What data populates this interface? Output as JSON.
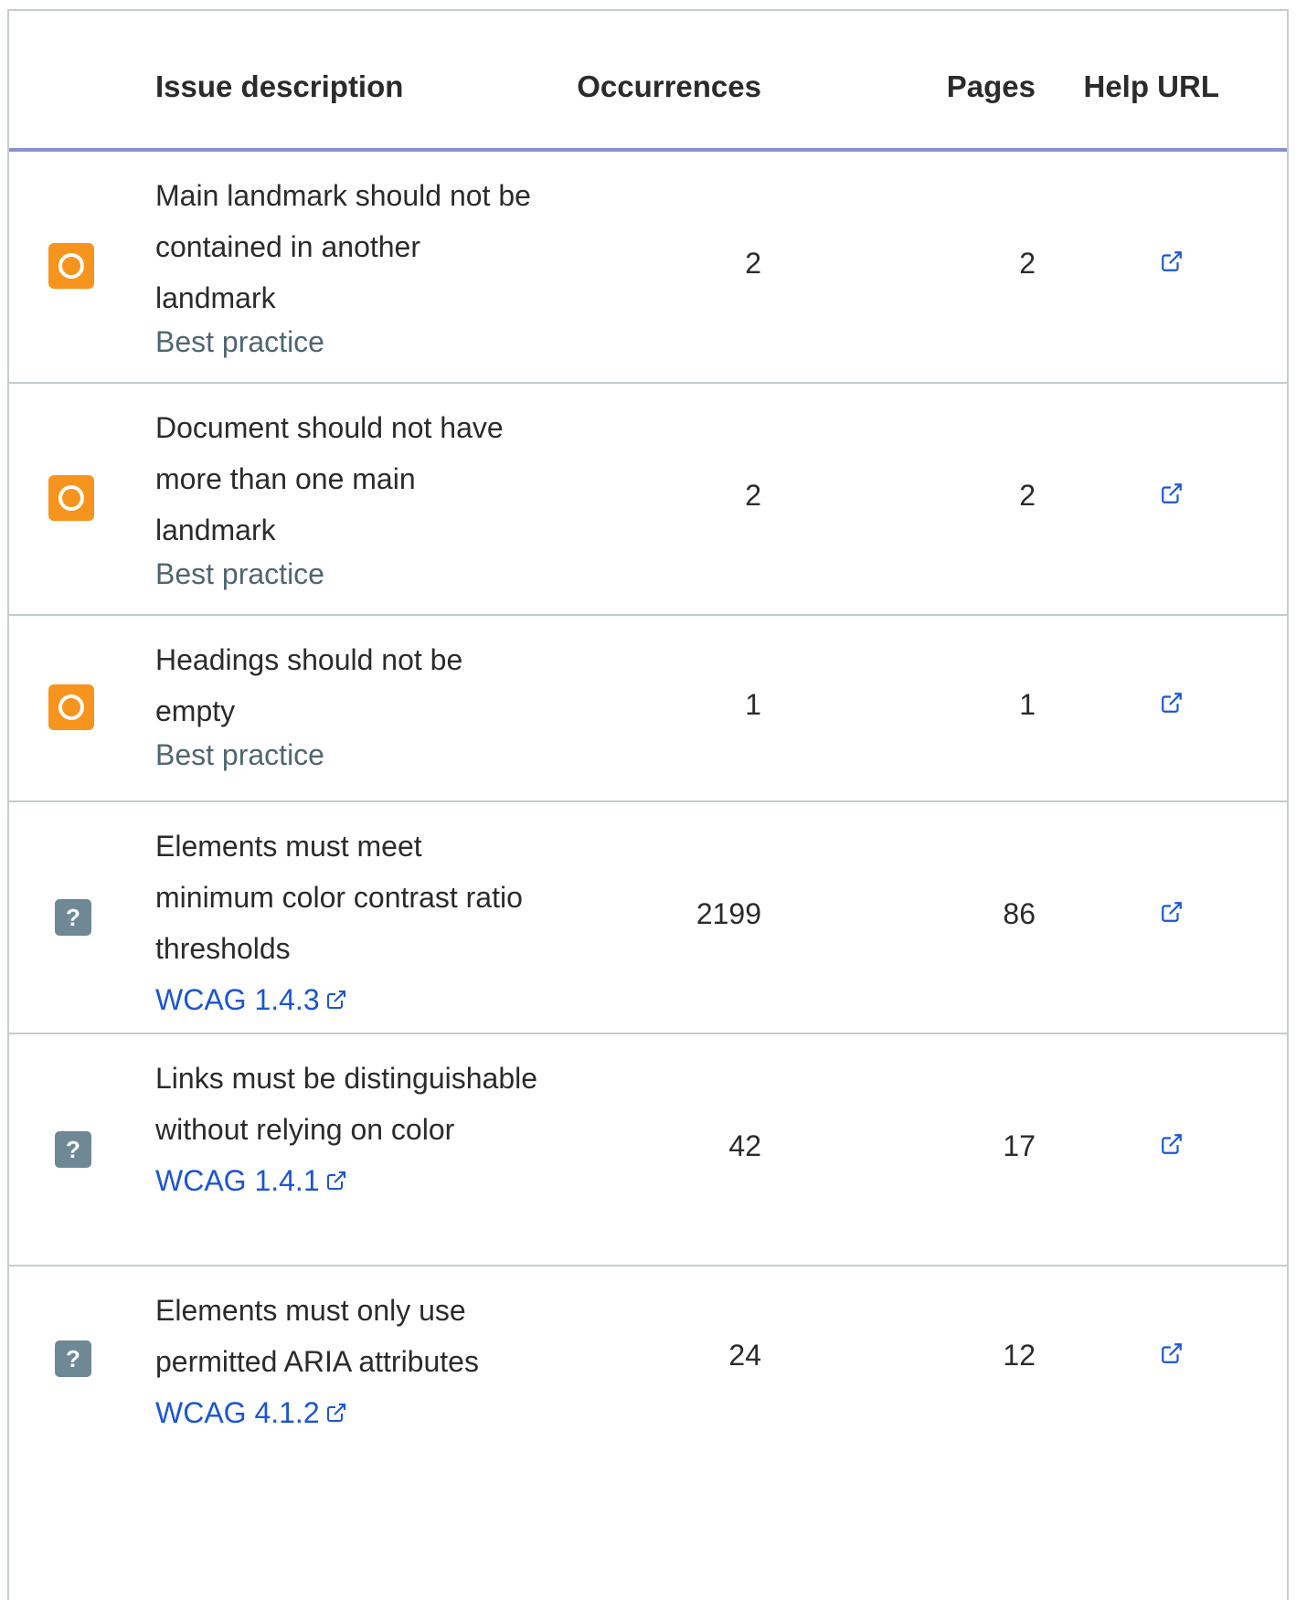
{
  "headers": {
    "issue": "Issue description",
    "occurrences": "Occurrences",
    "pages": "Pages",
    "help": "Help URL"
  },
  "rows": [
    {
      "severity_icon": "circle-warning-icon",
      "title": "Main landmark should not be contained in another landmark",
      "category": "Best practice",
      "wcag": "",
      "occurrences": "2",
      "pages": "2"
    },
    {
      "severity_icon": "circle-warning-icon",
      "title": "Document should not have more than one main landmark",
      "category": "Best practice",
      "wcag": "",
      "occurrences": "2",
      "pages": "2"
    },
    {
      "severity_icon": "circle-warning-icon",
      "title": "Headings should not be empty",
      "category": "Best practice",
      "wcag": "",
      "occurrences": "1",
      "pages": "1"
    },
    {
      "severity_icon": "question-icon",
      "title": "Elements must meet minimum color contrast ratio thresholds",
      "category": "",
      "wcag": "WCAG 1.4.3",
      "occurrences": "2199",
      "pages": "86"
    },
    {
      "severity_icon": "question-icon",
      "title": "Links must be distinguishable without relying on color",
      "category": "",
      "wcag": "WCAG 1.4.1",
      "occurrences": "42",
      "pages": "17"
    },
    {
      "severity_icon": "question-icon",
      "title": "Elements must only use permitted ARIA attributes",
      "category": "",
      "wcag": "WCAG 4.1.2",
      "occurrences": "24",
      "pages": "12"
    }
  ],
  "colors": {
    "warning": "#f7941d",
    "question": "#6e8896",
    "link": "#1a55d6",
    "category": "#4f6670",
    "border": "#c3ccd1",
    "header_underline": "#8a8fd0"
  },
  "question_glyph": "?"
}
